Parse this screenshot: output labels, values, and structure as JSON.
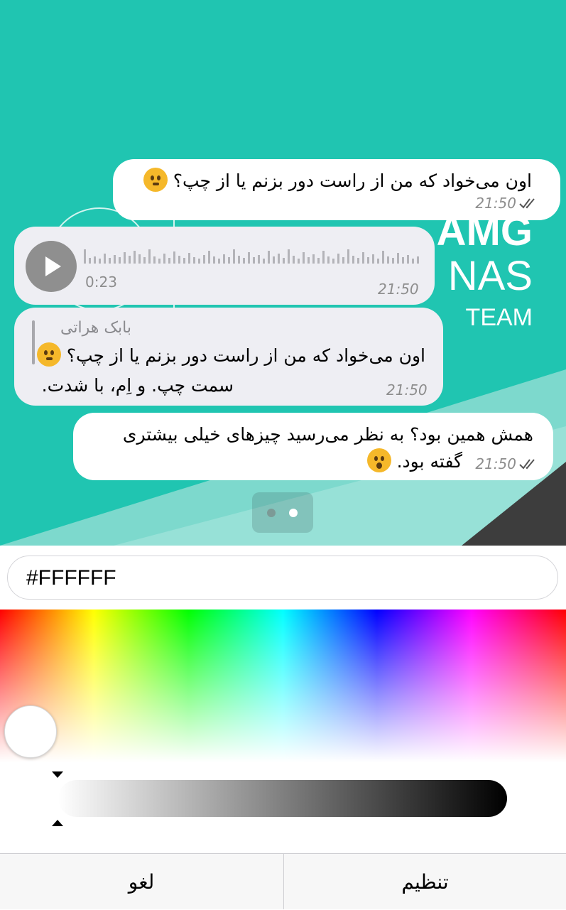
{
  "preview": {
    "background_color": "#20c5b1",
    "logo_text": [
      "AMG",
      "NAS",
      "TEAM"
    ],
    "messages": [
      {
        "type": "outgoing",
        "text": "اون می‌خواد که من از راست دور بزنم یا از چپ؟",
        "emoji": "thinking-face",
        "time": "21:50"
      },
      {
        "type": "incoming-voice",
        "duration": "0:23",
        "time": "21:50"
      },
      {
        "type": "incoming-reply",
        "quote_author": "بابک هراتی",
        "quote_text": "اون می‌خواد که من از راست دور بزنم یا از چپ؟",
        "quote_emoji": "thinking-face",
        "text": "سمت چپ. و اِم، با شدت.",
        "time": "21:50"
      },
      {
        "type": "outgoing",
        "line1": "همش همین بود؟ به نظر می‌رسید چیزهای خیلی بیشتری",
        "line2": "گفته بود.",
        "emoji": "hushed-face",
        "time": "21:50"
      }
    ],
    "pager": {
      "pages": 2,
      "active": 2
    }
  },
  "picker": {
    "hex_value": "#FFFFFF",
    "selected_color": "#FFFFFF",
    "brightness_level": 0
  },
  "actions": {
    "cancel_label": "لغو",
    "set_label": "تنظیم"
  }
}
